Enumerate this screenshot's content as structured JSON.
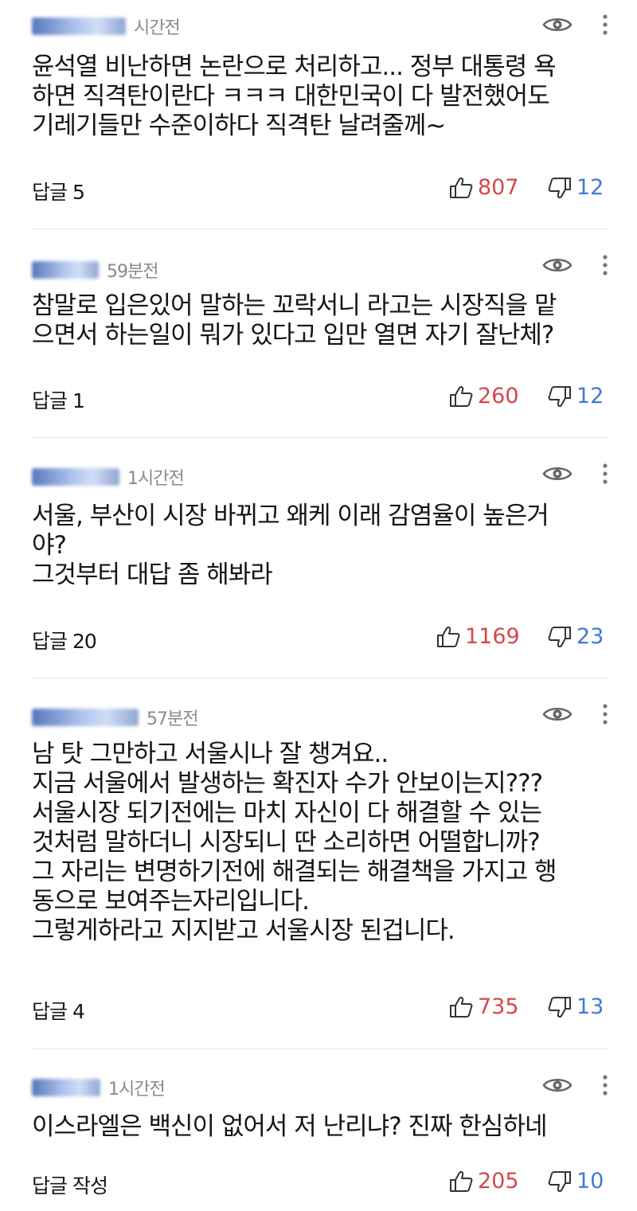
{
  "comments": [
    {
      "time": "시간전",
      "text": "윤석열 비난하면 논란으로 처리하고... 정부 대통령 욕\n하면 직격탄이란다 ㅋㅋㅋ 대한민국이 다 발전했어도\n기레기들만 수준이하다 직격탄 날려줄께~",
      "reply": "답글 5",
      "likes": "807",
      "dislikes": "12"
    },
    {
      "time": "59분전",
      "text": "참말로 입은있어 말하는 꼬락서니 라고는 시장직을 맡\n으면서 하는일이 뭐가 있다고 입만 열면 자기 잘난체?",
      "reply": "답글 1",
      "likes": "260",
      "dislikes": "12"
    },
    {
      "time": "1시간전",
      "text": "서울, 부산이 시장 바뀌고 왜케 이래 감염율이 높은거\n야?\n그것부터 대답 좀 해봐라",
      "reply": "답글 20",
      "likes": "1169",
      "dislikes": "23"
    },
    {
      "time": "57분전",
      "text": "남 탓 그만하고 서울시나 잘 챙겨요..\n지금 서울에서 발생하는 확진자 수가 안보이는지???\n서울시장 되기전에는 마치 자신이 다 해결할 수 있는\n것처럼 말하더니 시장되니 딴 소리하면 어떨합니까?\n그 자리는 변명하기전에 해결되는 해결책을 가지고 행\n동으로 보여주는자리입니다.\n그렇게하라고 지지받고 서울시장 된겁니다.",
      "reply": "답글 4",
      "likes": "735",
      "dislikes": "13"
    },
    {
      "time": "1시간전",
      "text": "이스라엘은 백신이 없어서 저 난리냐? 진짜 한심하네",
      "reply": "답글 작성",
      "likes": "205",
      "dislikes": "10"
    }
  ],
  "colors": {
    "like": "#d4474b",
    "dislike": "#3d7bd6",
    "time": "#8a8a8a",
    "divider": "#e4e4e4"
  },
  "icons": {
    "eye": "eye-icon",
    "more": "kebab-menu-icon",
    "like": "thumbs-up-icon",
    "dislike": "thumbs-down-icon"
  }
}
